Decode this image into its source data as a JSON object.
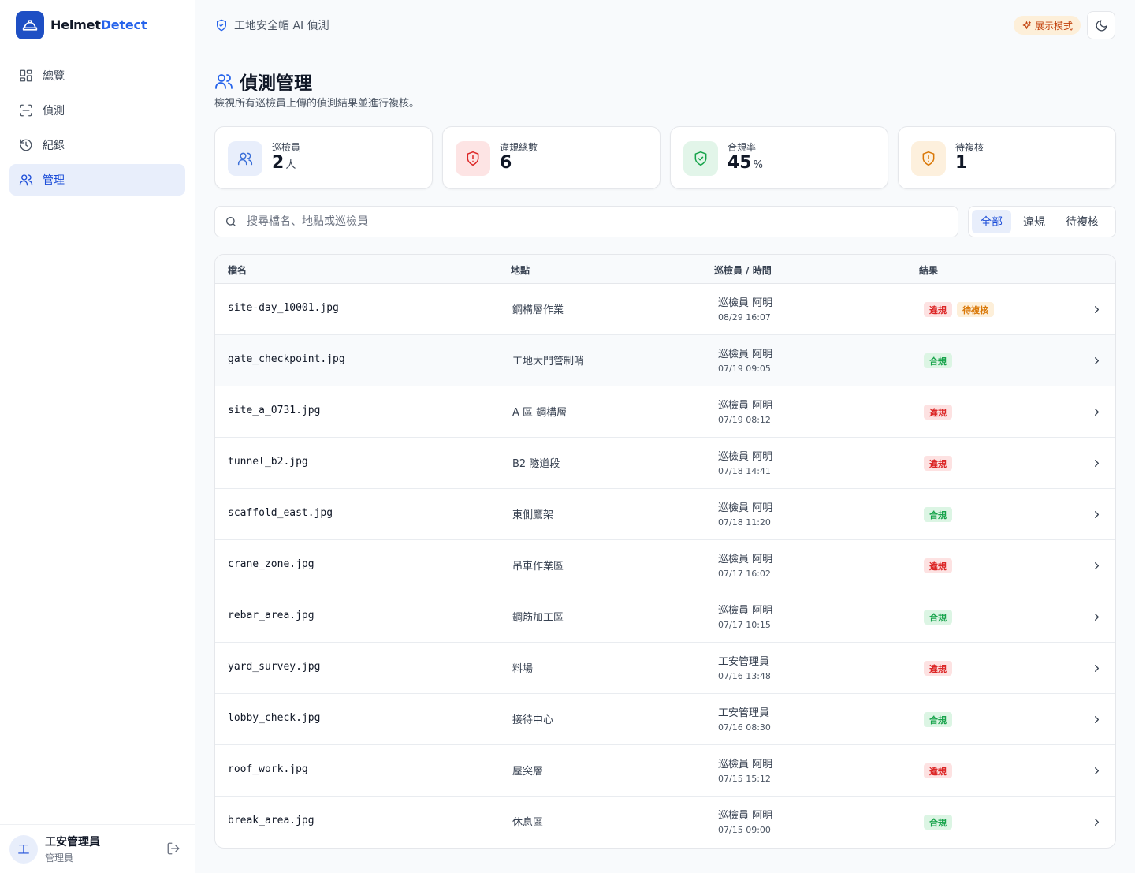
{
  "brand": {
    "name_prefix": "Helmet",
    "name_suffix": "Detect"
  },
  "nav": [
    {
      "label": "總覽",
      "icon": "grid-icon",
      "active": false
    },
    {
      "label": "偵測",
      "icon": "scan-icon",
      "active": false
    },
    {
      "label": "紀錄",
      "icon": "history-icon",
      "active": false
    },
    {
      "label": "管理",
      "icon": "users-icon",
      "active": true
    }
  ],
  "user": {
    "avatar": "工",
    "name": "工安管理員",
    "role": "管理員"
  },
  "topbar": {
    "breadcrumb": "工地安全帽 AI 偵測",
    "demo_label": "展示模式"
  },
  "page": {
    "title": "偵測管理",
    "subtitle": "檢視所有巡檢員上傳的偵測結果並進行複核。"
  },
  "stats": [
    {
      "label": "巡檢員",
      "value": "2",
      "unit": "人",
      "icon": "users-icon",
      "color": "#3b6fd8",
      "bg": "#e8eefb"
    },
    {
      "label": "違規總數",
      "value": "6",
      "unit": "",
      "icon": "shield-alert-icon",
      "color": "#dc2626",
      "bg": "#fde4e4"
    },
    {
      "label": "合規率",
      "value": "45",
      "unit": "%",
      "icon": "shield-check-icon",
      "color": "#16a34a",
      "bg": "#e2f5e9"
    },
    {
      "label": "待複核",
      "value": "1",
      "unit": "",
      "icon": "shield-pending-icon",
      "color": "#d97706",
      "bg": "#fdf0dd"
    }
  ],
  "search": {
    "placeholder": "搜尋檔名、地點或巡檢員",
    "value": ""
  },
  "filters": [
    {
      "label": "全部",
      "active": true
    },
    {
      "label": "違規",
      "active": false
    },
    {
      "label": "待複核",
      "active": false
    }
  ],
  "table": {
    "headers": {
      "file": "檔名",
      "location": "地點",
      "inspector_time": "巡檢員 / 時間",
      "result": "結果"
    },
    "rows": [
      {
        "file": "site-day_10001.jpg",
        "location": "鋼構層作業",
        "inspector": "巡檢員 阿明",
        "time": "08/29 16:07",
        "badges": [
          {
            "label": "違規",
            "type": "viol"
          },
          {
            "label": "待複核",
            "type": "pend"
          }
        ]
      },
      {
        "file": "gate_checkpoint.jpg",
        "location": "工地大門管制哨",
        "inspector": "巡檢員 阿明",
        "time": "07/19 09:05",
        "badges": [
          {
            "label": "合規",
            "type": "ok"
          }
        ]
      },
      {
        "file": "site_a_0731.jpg",
        "location": "A 區 鋼構層",
        "inspector": "巡檢員 阿明",
        "time": "07/19 08:12",
        "badges": [
          {
            "label": "違規",
            "type": "viol"
          }
        ]
      },
      {
        "file": "tunnel_b2.jpg",
        "location": "B2 隧道段",
        "inspector": "巡檢員 阿明",
        "time": "07/18 14:41",
        "badges": [
          {
            "label": "違規",
            "type": "viol"
          }
        ]
      },
      {
        "file": "scaffold_east.jpg",
        "location": "東側鷹架",
        "inspector": "巡檢員 阿明",
        "time": "07/18 11:20",
        "badges": [
          {
            "label": "合規",
            "type": "ok"
          }
        ]
      },
      {
        "file": "crane_zone.jpg",
        "location": "吊車作業區",
        "inspector": "巡檢員 阿明",
        "time": "07/17 16:02",
        "badges": [
          {
            "label": "違規",
            "type": "viol"
          }
        ]
      },
      {
        "file": "rebar_area.jpg",
        "location": "鋼筋加工區",
        "inspector": "巡檢員 阿明",
        "time": "07/17 10:15",
        "badges": [
          {
            "label": "合規",
            "type": "ok"
          }
        ]
      },
      {
        "file": "yard_survey.jpg",
        "location": "料場",
        "inspector": "工安管理員",
        "time": "07/16 13:48",
        "badges": [
          {
            "label": "違規",
            "type": "viol"
          }
        ]
      },
      {
        "file": "lobby_check.jpg",
        "location": "接待中心",
        "inspector": "工安管理員",
        "time": "07/16 08:30",
        "badges": [
          {
            "label": "合規",
            "type": "ok"
          }
        ]
      },
      {
        "file": "roof_work.jpg",
        "location": "屋突層",
        "inspector": "巡檢員 阿明",
        "time": "07/15 15:12",
        "badges": [
          {
            "label": "違規",
            "type": "viol"
          }
        ]
      },
      {
        "file": "break_area.jpg",
        "location": "休息區",
        "inspector": "巡檢員 阿明",
        "time": "07/15 09:00",
        "badges": [
          {
            "label": "合規",
            "type": "ok"
          }
        ]
      }
    ]
  }
}
